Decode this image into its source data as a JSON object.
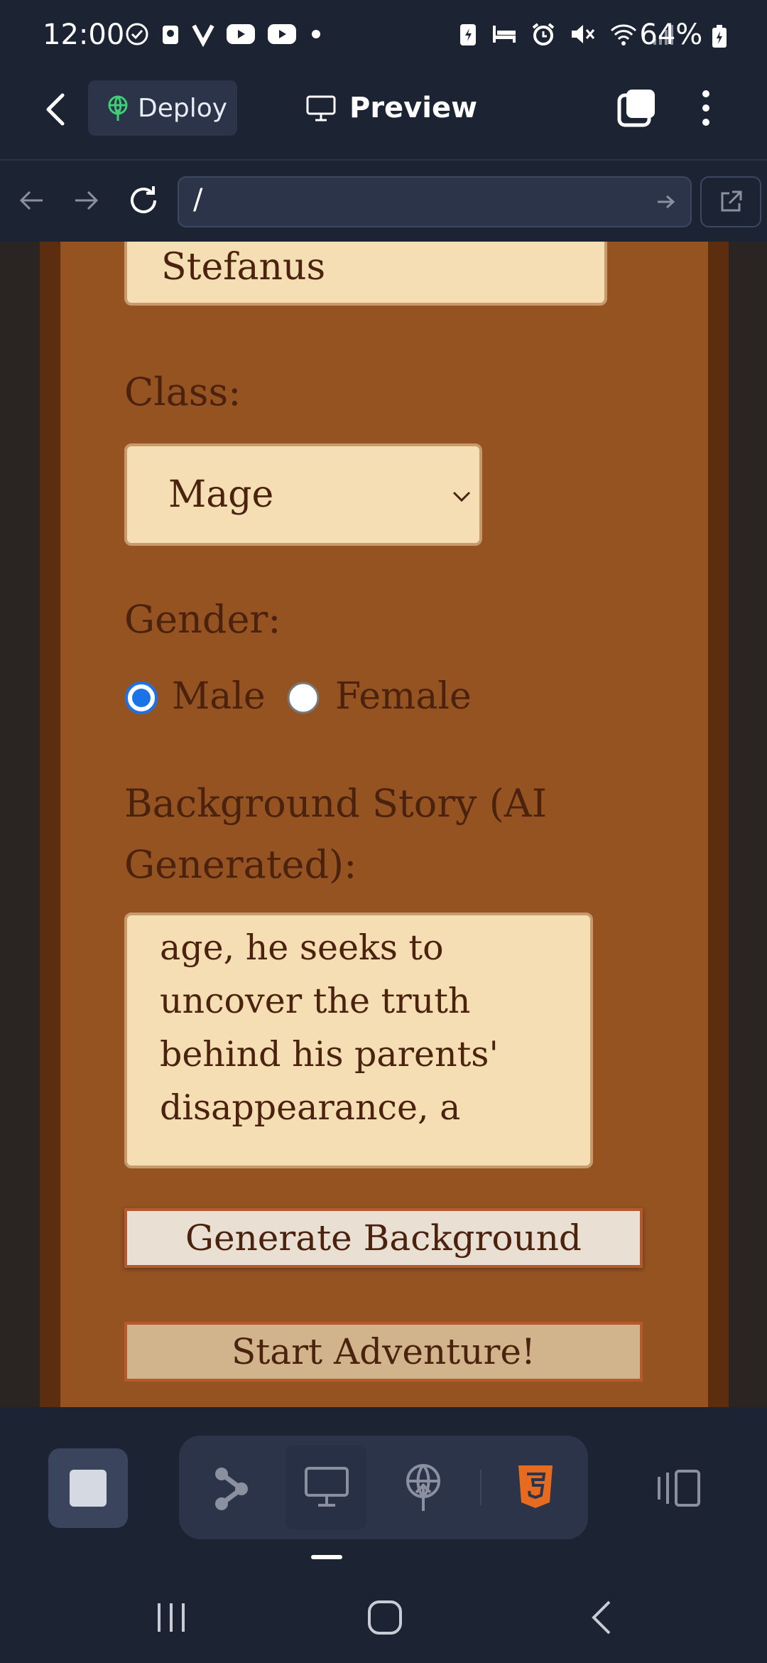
{
  "status_bar": {
    "time": "12:00",
    "battery": "64%",
    "left_icons": [
      "check-circle-icon",
      "bag-icon",
      "v-icon",
      "youtube-icon",
      "youtube-icon",
      "dot-icon"
    ],
    "right_icons": [
      "battery-saver-icon",
      "bed-icon",
      "alarm-icon",
      "mute-icon",
      "wifi-icon",
      "signal-icon"
    ]
  },
  "app_bar": {
    "deploy_label": "Deploy",
    "preview_label": "Preview"
  },
  "url_bar": {
    "url": "/"
  },
  "form": {
    "name_value": "Stefanus",
    "class_label": "Class:",
    "class_value": "Mage",
    "gender_label": "Gender:",
    "gender_options": [
      "Male",
      "Female"
    ],
    "gender_selected": "Male",
    "background_label": "Background Story (AI Generated):",
    "background_lines": [
      "age, he seeks to",
      "uncover the truth",
      "behind his parents'",
      "disappearance, a"
    ],
    "generate_button": "Generate Background",
    "start_button": "Start Adventure!"
  },
  "colors": {
    "app_bg": "#1c2333",
    "panel": "#955322",
    "frame": "#5c2e0f",
    "field": "#f5deb3",
    "text": "#4a220d",
    "radio_selected": "#1a73e8",
    "html5_badge": "#e66a1f"
  },
  "toolbar": {
    "icons": [
      "stop-icon",
      "branch-icon",
      "desktop-icon",
      "deploy-icon",
      "html5-icon",
      "device-toggle-icon"
    ]
  }
}
